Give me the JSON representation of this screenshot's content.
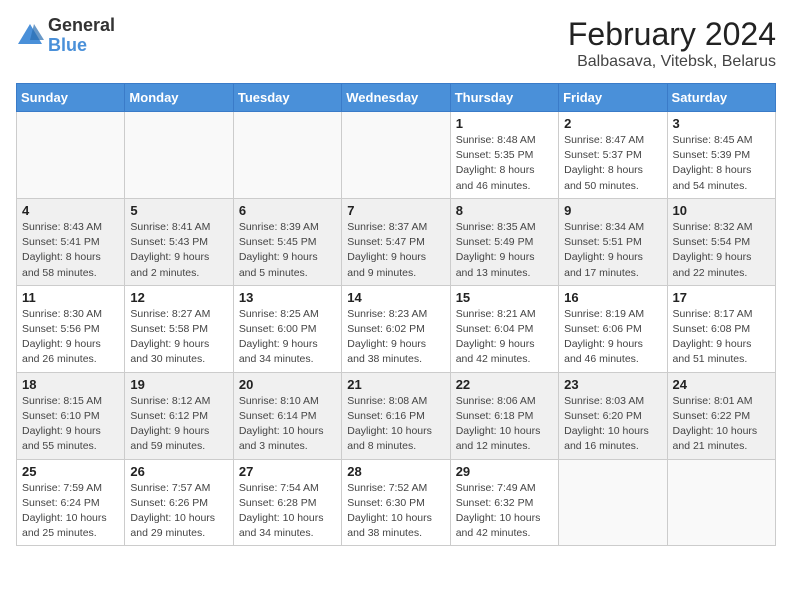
{
  "header": {
    "logo_general": "General",
    "logo_blue": "Blue",
    "month_title": "February 2024",
    "location": "Balbasava, Vitebsk, Belarus"
  },
  "days_of_week": [
    "Sunday",
    "Monday",
    "Tuesday",
    "Wednesday",
    "Thursday",
    "Friday",
    "Saturday"
  ],
  "weeks": [
    {
      "shaded": false,
      "days": [
        {
          "num": "",
          "info": ""
        },
        {
          "num": "",
          "info": ""
        },
        {
          "num": "",
          "info": ""
        },
        {
          "num": "",
          "info": ""
        },
        {
          "num": "1",
          "info": "Sunrise: 8:48 AM\nSunset: 5:35 PM\nDaylight: 8 hours\nand 46 minutes."
        },
        {
          "num": "2",
          "info": "Sunrise: 8:47 AM\nSunset: 5:37 PM\nDaylight: 8 hours\nand 50 minutes."
        },
        {
          "num": "3",
          "info": "Sunrise: 8:45 AM\nSunset: 5:39 PM\nDaylight: 8 hours\nand 54 minutes."
        }
      ]
    },
    {
      "shaded": true,
      "days": [
        {
          "num": "4",
          "info": "Sunrise: 8:43 AM\nSunset: 5:41 PM\nDaylight: 8 hours\nand 58 minutes."
        },
        {
          "num": "5",
          "info": "Sunrise: 8:41 AM\nSunset: 5:43 PM\nDaylight: 9 hours\nand 2 minutes."
        },
        {
          "num": "6",
          "info": "Sunrise: 8:39 AM\nSunset: 5:45 PM\nDaylight: 9 hours\nand 5 minutes."
        },
        {
          "num": "7",
          "info": "Sunrise: 8:37 AM\nSunset: 5:47 PM\nDaylight: 9 hours\nand 9 minutes."
        },
        {
          "num": "8",
          "info": "Sunrise: 8:35 AM\nSunset: 5:49 PM\nDaylight: 9 hours\nand 13 minutes."
        },
        {
          "num": "9",
          "info": "Sunrise: 8:34 AM\nSunset: 5:51 PM\nDaylight: 9 hours\nand 17 minutes."
        },
        {
          "num": "10",
          "info": "Sunrise: 8:32 AM\nSunset: 5:54 PM\nDaylight: 9 hours\nand 22 minutes."
        }
      ]
    },
    {
      "shaded": false,
      "days": [
        {
          "num": "11",
          "info": "Sunrise: 8:30 AM\nSunset: 5:56 PM\nDaylight: 9 hours\nand 26 minutes."
        },
        {
          "num": "12",
          "info": "Sunrise: 8:27 AM\nSunset: 5:58 PM\nDaylight: 9 hours\nand 30 minutes."
        },
        {
          "num": "13",
          "info": "Sunrise: 8:25 AM\nSunset: 6:00 PM\nDaylight: 9 hours\nand 34 minutes."
        },
        {
          "num": "14",
          "info": "Sunrise: 8:23 AM\nSunset: 6:02 PM\nDaylight: 9 hours\nand 38 minutes."
        },
        {
          "num": "15",
          "info": "Sunrise: 8:21 AM\nSunset: 6:04 PM\nDaylight: 9 hours\nand 42 minutes."
        },
        {
          "num": "16",
          "info": "Sunrise: 8:19 AM\nSunset: 6:06 PM\nDaylight: 9 hours\nand 46 minutes."
        },
        {
          "num": "17",
          "info": "Sunrise: 8:17 AM\nSunset: 6:08 PM\nDaylight: 9 hours\nand 51 minutes."
        }
      ]
    },
    {
      "shaded": true,
      "days": [
        {
          "num": "18",
          "info": "Sunrise: 8:15 AM\nSunset: 6:10 PM\nDaylight: 9 hours\nand 55 minutes."
        },
        {
          "num": "19",
          "info": "Sunrise: 8:12 AM\nSunset: 6:12 PM\nDaylight: 9 hours\nand 59 minutes."
        },
        {
          "num": "20",
          "info": "Sunrise: 8:10 AM\nSunset: 6:14 PM\nDaylight: 10 hours\nand 3 minutes."
        },
        {
          "num": "21",
          "info": "Sunrise: 8:08 AM\nSunset: 6:16 PM\nDaylight: 10 hours\nand 8 minutes."
        },
        {
          "num": "22",
          "info": "Sunrise: 8:06 AM\nSunset: 6:18 PM\nDaylight: 10 hours\nand 12 minutes."
        },
        {
          "num": "23",
          "info": "Sunrise: 8:03 AM\nSunset: 6:20 PM\nDaylight: 10 hours\nand 16 minutes."
        },
        {
          "num": "24",
          "info": "Sunrise: 8:01 AM\nSunset: 6:22 PM\nDaylight: 10 hours\nand 21 minutes."
        }
      ]
    },
    {
      "shaded": false,
      "days": [
        {
          "num": "25",
          "info": "Sunrise: 7:59 AM\nSunset: 6:24 PM\nDaylight: 10 hours\nand 25 minutes."
        },
        {
          "num": "26",
          "info": "Sunrise: 7:57 AM\nSunset: 6:26 PM\nDaylight: 10 hours\nand 29 minutes."
        },
        {
          "num": "27",
          "info": "Sunrise: 7:54 AM\nSunset: 6:28 PM\nDaylight: 10 hours\nand 34 minutes."
        },
        {
          "num": "28",
          "info": "Sunrise: 7:52 AM\nSunset: 6:30 PM\nDaylight: 10 hours\nand 38 minutes."
        },
        {
          "num": "29",
          "info": "Sunrise: 7:49 AM\nSunset: 6:32 PM\nDaylight: 10 hours\nand 42 minutes."
        },
        {
          "num": "",
          "info": ""
        },
        {
          "num": "",
          "info": ""
        }
      ]
    }
  ]
}
